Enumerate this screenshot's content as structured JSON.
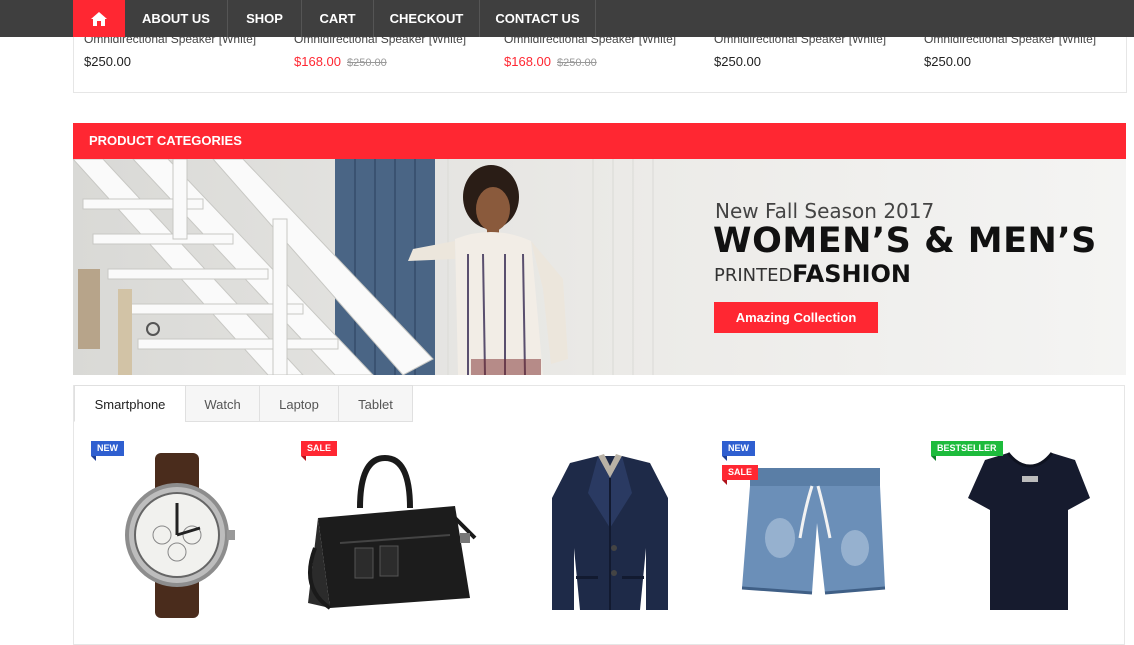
{
  "nav": {
    "home_icon": "home-icon",
    "items": [
      "ABOUT US",
      "SHOP",
      "CART",
      "CHECKOUT",
      "CONTACT US"
    ]
  },
  "product_strip": [
    {
      "name": "Omnidirectional Speaker [White]",
      "price": "$250.00",
      "old_price": ""
    },
    {
      "name": "Omnidirectional Speaker [White]",
      "price": "$168.00",
      "old_price": "$250.00"
    },
    {
      "name": "Omnidirectional Speaker [White]",
      "price": "$168.00",
      "old_price": "$250.00"
    },
    {
      "name": "Omnidirectional Speaker [White]",
      "price": "$250.00",
      "old_price": ""
    },
    {
      "name": "Omnidirectional Speaker [White]",
      "price": "$250.00",
      "old_price": ""
    }
  ],
  "categories": {
    "title": "PRODUCT CATEGORIES",
    "banner": {
      "season": "New Fall Season 2017",
      "headline": "WOMEN’S & MEN’S",
      "printed": "PRINTED",
      "fashion": "FASHION",
      "button": "Amazing Collection"
    },
    "tabs": [
      "Smartphone",
      "Watch",
      "Laptop",
      "Tablet"
    ],
    "active_tab": "Smartphone"
  },
  "products": [
    {
      "item": "wristwatch",
      "badges": [
        "NEW"
      ]
    },
    {
      "item": "leather-bag",
      "badges": [
        "SALE"
      ]
    },
    {
      "item": "navy-blazer",
      "badges": []
    },
    {
      "item": "denim-shorts",
      "badges": [
        "NEW",
        "SALE"
      ]
    },
    {
      "item": "navy-tshirt",
      "badges": [
        "BESTSELLER"
      ]
    }
  ],
  "colors": {
    "accent": "#ff2732",
    "nav_bg": "#3f3f3f",
    "badge_new": "#2f5fd0",
    "badge_sale": "#ff2732",
    "badge_best": "#1dbb3c"
  }
}
